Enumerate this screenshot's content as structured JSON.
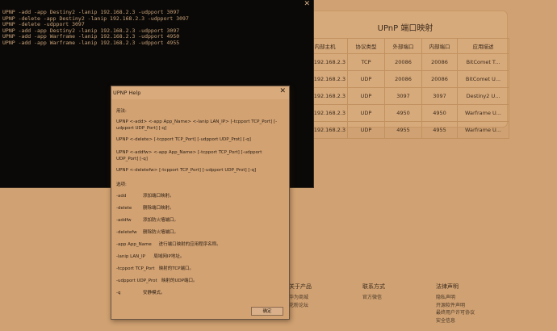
{
  "console": {
    "close_glyph": "✕",
    "lines": [
      "UPNP -add -app Destiny2 -lanip 192.168.2.3 -udpport 3097",
      "UPNP -delete -app Destiny2 -lanip 192.168.2.3 -udpport 3097",
      "UPNP -delete -udpport 3097",
      "UPNP -add -app Destiny2 -lanip 192.168.2.3 -udpport 3097",
      "UPNP -add -app Warframe -lanip 192.168.2.3 -udpport 4950",
      "UPNP -add -app Warframe -lanip 192.168.2.3 -udpport 4955"
    ]
  },
  "web": {
    "panel_title": "UPnP 端口映射",
    "table": {
      "headers": [
        "内部主机",
        "协议类型",
        "外部端口",
        "内部端口",
        "应用描述"
      ],
      "rows": [
        [
          "192.168.2.3",
          "TCP",
          "20086",
          "20086",
          "BitComet T..."
        ],
        [
          "192.168.2.3",
          "UDP",
          "20086",
          "20086",
          "BitComet U..."
        ],
        [
          "192.168.2.3",
          "UDP",
          "3097",
          "3097",
          "Destiny2 U..."
        ],
        [
          "192.168.2.3",
          "UDP",
          "4950",
          "4950",
          "Warframe U..."
        ],
        [
          "192.168.2.3",
          "UDP",
          "4955",
          "4955",
          "Warframe U..."
        ]
      ]
    },
    "footer": [
      {
        "heading": "关于产品",
        "links": [
          "华为商城",
          "花粉论坛"
        ]
      },
      {
        "heading": "联系方式",
        "links": [
          "官方微信"
        ]
      },
      {
        "heading": "法律声明",
        "links": [
          "隐私声明",
          "开源软件声明",
          "最终用户许可协议",
          "安全信息"
        ]
      }
    ]
  },
  "dialog": {
    "title": "UPNP Help",
    "close_glyph": "✕",
    "usage_label": "用法:",
    "usages": [
      "UPNP <-add> <-app App_Name> <-lanip LAN_IP> [-tcpport TCP_Port] [-udpport UDP_Port] [-q]",
      "UPNP <-delete> [-tcpport TCP_Port] [-udpport UDP_Prot] [-q]",
      "UPNP <-addfw> <-app App_Name> [-tcpport TCP_Port] [-udpport UDP_Port] [-q]",
      "UPNP <-deletefw> [-tcpport TCP_Port] [-udpport UDP_Prot] [-q]"
    ],
    "options_label": "选项:",
    "options": [
      {
        "name": "-add",
        "desc": "添加端口映射。"
      },
      {
        "name": "-delete",
        "desc": "删除端口映射。"
      },
      {
        "name": "-addfw",
        "desc": "添加防火墙端口。"
      },
      {
        "name": "-deletefw",
        "desc": "删除防火墙端口。"
      },
      {
        "name": "-app App_Name",
        "desc": "进行端口映射的应用程序名称。"
      },
      {
        "name": "-lanip LAN_IP",
        "desc": "局域网IP地址。"
      },
      {
        "name": "-tcpport TCP_Port",
        "desc": "映射的TCP端口。"
      },
      {
        "name": "-udpport UDP_Prot",
        "desc": "映射的UDP端口。"
      },
      {
        "name": "-q",
        "desc": "安静模式。"
      }
    ],
    "ok_label": "确定"
  }
}
